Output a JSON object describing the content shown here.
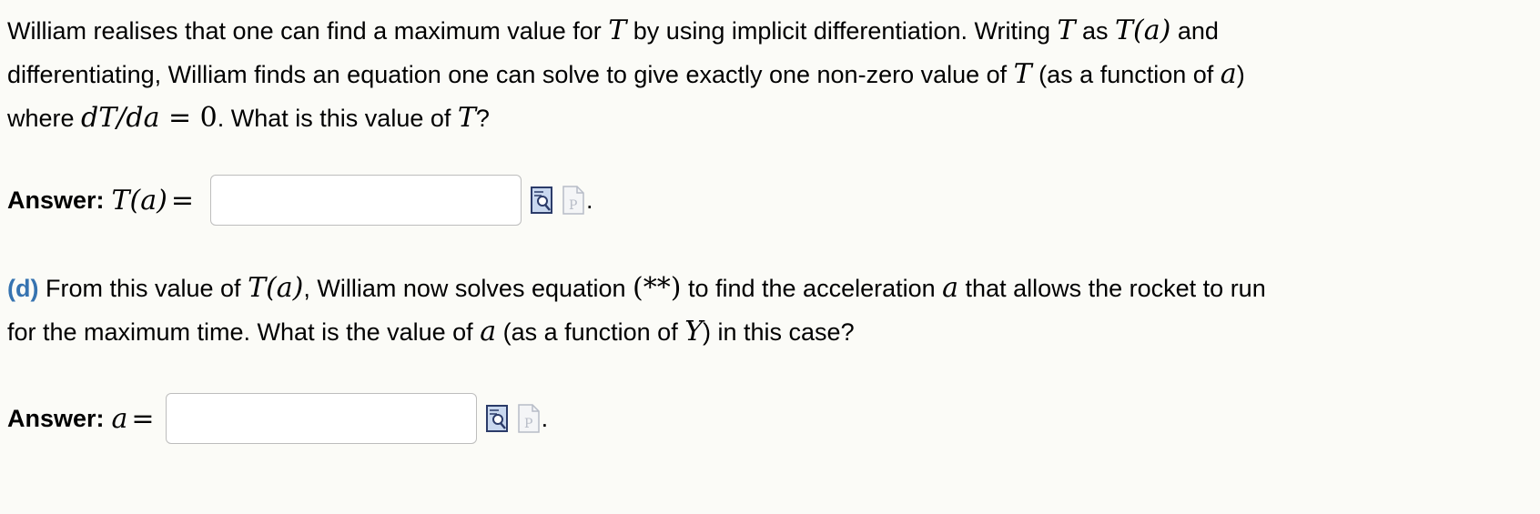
{
  "part_c": {
    "line1_a": "William realises that one can find a maximum value for ",
    "line1_T1": "T",
    "line1_b": " by using implicit differentiation. Writing ",
    "line1_T2": "T",
    "line1_c": " as ",
    "line1_Ta": "T(a)",
    "line1_d": " and",
    "line2_a": "differentiating, William finds an equation one can solve to give exactly one non-zero value of ",
    "line2_T": "T",
    "line2_b": " (as a function of ",
    "line2_var": "a",
    "line2_c": ")",
    "line3_a": "where ",
    "line3_eq": "dT/da",
    "line3_eq2": " = 0",
    "line3_b": ". What is this value of ",
    "line3_T": "T",
    "line3_c": "?"
  },
  "answer_c": {
    "label": "Answer:",
    "math_lhs": "T(a)",
    "math_eq": " = ",
    "input_value": "",
    "preview_icon": "preview-icon",
    "preview_icon_alt": "formula-preview-icon",
    "trailing": "."
  },
  "part_d": {
    "label": "(d)",
    "line1_a": " From this value of ",
    "line1_Ta": "T(a)",
    "line1_b": ", William now solves equation ",
    "line1_eqref": "(**)",
    "line1_c": " to find the acceleration ",
    "line1_var": "a",
    "line1_d": " that allows the rocket to run",
    "line2_a": "for the maximum time. What is the value of ",
    "line2_var": "a",
    "line2_b": " (as a function of ",
    "line2_Y": "Y",
    "line2_c": ") in this case?"
  },
  "answer_d": {
    "label": "Answer:",
    "math_lhs": "a",
    "math_eq": " = ",
    "input_value": "",
    "trailing": "."
  },
  "colors": {
    "background": "#fbfbf7",
    "part_label": "#3673b0",
    "input_border": "#bdbdbd"
  }
}
